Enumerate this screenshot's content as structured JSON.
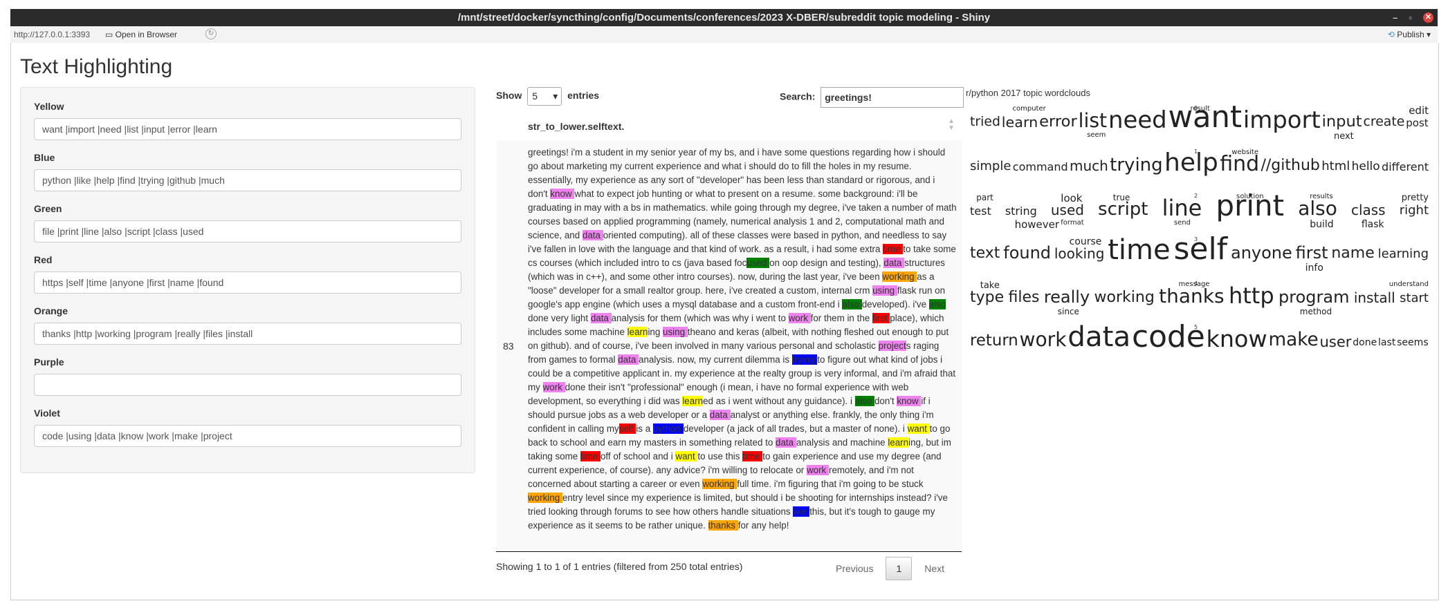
{
  "window": {
    "title": "/mnt/street/docker/syncthing/config/Documents/conferences/2023 X-DBER/subreddit topic modeling - Shiny",
    "controls": [
      "–",
      "▫",
      "✕"
    ]
  },
  "toolbar": {
    "url": "http://127.0.0.1:3393",
    "open_in_browser": "Open in Browser",
    "publish": "Publish"
  },
  "app": {
    "title": "Text Highlighting"
  },
  "fields": [
    {
      "label": "Yellow",
      "value": "want |import |need |list |input |error |learn"
    },
    {
      "label": "Blue",
      "value": "python |like |help |find |trying |github |much"
    },
    {
      "label": "Green",
      "value": "file |print |line |also |script |class |used"
    },
    {
      "label": "Red",
      "value": "https |self |time |anyone |first |name |found"
    },
    {
      "label": "Orange",
      "value": "thanks |http |working |program |really |files |install"
    },
    {
      "label": "Purple",
      "value": ""
    },
    {
      "label": "Violet",
      "value": "code |using |data |know |work |make |project"
    }
  ],
  "colors": {
    "yellow": "#ffff00",
    "blue": "#0000ff",
    "green": "#008000",
    "red": "#ff0000",
    "orange": "#ffa500",
    "violet": "#ee82ee"
  },
  "table": {
    "show_label": "Show",
    "entries_value": "5",
    "entries_label": "entries",
    "search_label": "Search:",
    "search_value": "greetings!",
    "column": "str_to_lower.selftext.",
    "row_id": "83",
    "info": "Showing 1 to 1 of 1 entries (filtered from 250 total entries)",
    "prev": "Previous",
    "page": "1",
    "next": "Next"
  },
  "post_segments": [
    [
      "greetings! i'm a student in my senior year of my bs, and i have some questions regarding how i should go about marketing my current experience and what i should do to fill the holes in my resume. essentially, my experience as any sort of \"developer\" has been less than standard or rigorous, and i don't ",
      ""
    ],
    [
      "know ",
      "v"
    ],
    [
      "what to expect job hunting or what to present on a resume. some background: i'll be graduating in may with a bs in mathematics. while going through my degree, i've taken a number of math courses based on applied programming (namely, numerical analysis 1 and 2, computational math and science, and ",
      ""
    ],
    [
      "data ",
      "v"
    ],
    [
      "oriented computing). all of these classes were based in python, and needless to say i've fallen in love with the language and that kind of work. as a result, i had some extra ",
      ""
    ],
    [
      "time ",
      "r"
    ],
    [
      "to take some cs courses (which included intro to cs (java based foc",
      ""
    ],
    [
      "used ",
      "g"
    ],
    [
      "on oop design and testing), ",
      ""
    ],
    [
      "data ",
      "v"
    ],
    [
      "structures (which was in c++), and some other intro courses). now, during the last year, i've been ",
      ""
    ],
    [
      "working ",
      "o"
    ],
    [
      "as a \"loose\" developer for a small realtor group. here, i've created a custom, internal crm ",
      ""
    ],
    [
      "using ",
      "v"
    ],
    [
      "flask run on google's app engine (which uses a mysql database and a custom front-end i ",
      ""
    ],
    [
      "also ",
      "g"
    ],
    [
      "developed). i've ",
      ""
    ],
    [
      "also ",
      "g"
    ],
    [
      "done very light ",
      ""
    ],
    [
      "data ",
      "v"
    ],
    [
      "analysis for them (which was why i went to ",
      ""
    ],
    [
      "work ",
      "v"
    ],
    [
      "for them in the ",
      ""
    ],
    [
      "first ",
      "r"
    ],
    [
      "place), which includes some machine ",
      ""
    ],
    [
      "learn",
      "y"
    ],
    [
      "ing ",
      ""
    ],
    [
      "using ",
      "v"
    ],
    [
      "theano and keras (albeit, with nothing fleshed out enough to put on github). and of course, i've been involved in many various personal and scholastic ",
      ""
    ],
    [
      "project",
      "v"
    ],
    [
      "s raging from games to formal ",
      ""
    ],
    [
      "data ",
      "v"
    ],
    [
      "analysis. now, my current dilemma is ",
      ""
    ],
    [
      "trying ",
      "b"
    ],
    [
      "to figure out what kind of jobs i could be a competitive applicant in. my experience at the realty group is very informal, and i'm afraid that my ",
      ""
    ],
    [
      "work ",
      "v"
    ],
    [
      "done their isn't \"professional\" enough (i mean, i have no formal experience with web development, so everything i did was ",
      ""
    ],
    [
      "learn",
      "y"
    ],
    [
      "ed as i went without any guidance). i ",
      ""
    ],
    [
      "also ",
      "g"
    ],
    [
      "don't ",
      ""
    ],
    [
      "know ",
      "v"
    ],
    [
      "if i should pursue jobs as a web developer or a ",
      ""
    ],
    [
      "data ",
      "v"
    ],
    [
      "analyst or anything else. frankly, the only thing i'm confident in calling my",
      ""
    ],
    [
      "self ",
      "r"
    ],
    [
      "is a ",
      ""
    ],
    [
      "python ",
      "b"
    ],
    [
      "developer (a jack of all trades, but a master of none). i ",
      ""
    ],
    [
      "want ",
      "y"
    ],
    [
      "to go back to school and earn my masters in something related to ",
      ""
    ],
    [
      "data ",
      "v"
    ],
    [
      "analysis and machine ",
      ""
    ],
    [
      "learn",
      "y"
    ],
    [
      "ing, but im taking some ",
      ""
    ],
    [
      "time ",
      "r"
    ],
    [
      "off of school and i ",
      ""
    ],
    [
      "want ",
      "y"
    ],
    [
      "to use this ",
      ""
    ],
    [
      "time ",
      "r"
    ],
    [
      "to gain experience and use my degree (and current experience, of course). any advice? i'm willing to relocate or ",
      ""
    ],
    [
      "work ",
      "v"
    ],
    [
      "remotely, and i'm not concerned about starting a career or even ",
      ""
    ],
    [
      "working ",
      "o"
    ],
    [
      "full time. i'm figuring that i'm going to be stuck ",
      ""
    ],
    [
      "working ",
      "o"
    ],
    [
      "entry level since my experience is limited, but should i be shooting for internships instead? i've tried looking through forums to see how others handle situations ",
      ""
    ],
    [
      "like ",
      "b"
    ],
    [
      "this, but it's tough to gauge my experience as it seems to be rather unique. ",
      ""
    ],
    [
      "thanks ",
      "o"
    ],
    [
      "for any help!",
      ""
    ]
  ],
  "wordcloud": {
    "title": "r/python 2017 topic wordclouds",
    "rows": [
      {
        "num": "0",
        "words": [
          [
            "tried",
            20
          ],
          [
            "learn",
            22
          ],
          [
            "error",
            24
          ],
          [
            "list",
            30
          ],
          [
            "need",
            36
          ],
          [
            "want",
            46
          ],
          [
            "import",
            36
          ],
          [
            "input",
            24
          ],
          [
            "create",
            20
          ],
          [
            "post",
            16
          ],
          [
            "computer",
            10
          ],
          [
            "seem",
            10
          ],
          [
            "result",
            10
          ],
          [
            "next",
            13
          ],
          [
            "edit",
            15
          ]
        ]
      },
      {
        "num": "1",
        "words": [
          [
            "simple",
            18
          ],
          [
            "command",
            16
          ],
          [
            "much",
            20
          ],
          [
            "trying",
            26
          ],
          [
            "help",
            36
          ],
          [
            "find",
            30
          ],
          [
            "//github",
            22
          ],
          [
            "html",
            18
          ],
          [
            "hello",
            17
          ],
          [
            "different",
            16
          ],
          [
            "website",
            10
          ]
        ]
      },
      {
        "num": "2",
        "words": [
          [
            "part",
            12
          ],
          [
            "test",
            16
          ],
          [
            "string",
            16
          ],
          [
            "used",
            20
          ],
          [
            "script",
            26
          ],
          [
            "line",
            32
          ],
          [
            "print",
            42
          ],
          [
            "also",
            28
          ],
          [
            "class",
            20
          ],
          [
            "right",
            18
          ],
          [
            "however",
            15
          ],
          [
            "look",
            15
          ],
          [
            "format",
            10
          ],
          [
            "true",
            12
          ],
          [
            "send",
            10
          ],
          [
            "solution",
            10
          ],
          [
            "build",
            14
          ],
          [
            "results",
            10
          ],
          [
            "flask",
            14
          ],
          [
            "pretty",
            13
          ]
        ]
      },
      {
        "num": "3",
        "words": [
          [
            "text",
            22
          ],
          [
            "found",
            24
          ],
          [
            "looking",
            20
          ],
          [
            "time",
            40
          ],
          [
            "self",
            44
          ],
          [
            "anyone",
            24
          ],
          [
            "first",
            24
          ],
          [
            "name",
            22
          ],
          [
            "learning",
            18
          ],
          [
            "course",
            14
          ],
          [
            "info",
            14
          ]
        ]
      },
      {
        "num": "4",
        "words": [
          [
            "take",
            13
          ],
          [
            "since",
            12
          ],
          [
            "type",
            22
          ],
          [
            "files",
            22
          ],
          [
            "really",
            24
          ],
          [
            "working",
            22
          ],
          [
            "thanks",
            28
          ],
          [
            "http",
            32
          ],
          [
            "program",
            24
          ],
          [
            "install",
            20
          ],
          [
            "start",
            18
          ],
          [
            "message",
            10
          ],
          [
            "method",
            12
          ],
          [
            "understand",
            10
          ]
        ]
      },
      {
        "num": "5",
        "words": [
          [
            "return",
            26
          ],
          [
            "work",
            32
          ],
          [
            "data",
            46
          ],
          [
            "code",
            50
          ],
          [
            "know",
            38
          ],
          [
            "make",
            30
          ],
          [
            "user",
            24
          ],
          [
            "done",
            16
          ],
          [
            "last",
            16
          ],
          [
            "seems",
            16
          ]
        ]
      }
    ]
  }
}
